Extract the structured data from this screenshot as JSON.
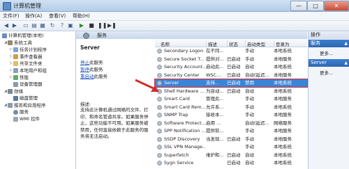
{
  "window": {
    "title": "计算机管理",
    "min_label": "—",
    "max_label": "□",
    "close_label": "✕"
  },
  "menu": [
    "文件(F)",
    "操作(A)",
    "查看(V)",
    "帮助(H)"
  ],
  "tree": {
    "root": "计算机管理(本地)",
    "system_tools": "系统工具",
    "task_scheduler": "任务计划程序",
    "event_viewer": "事件查看器",
    "shared_folders": "共享文件夹",
    "local_users": "本地用户和组",
    "performance": "性能",
    "device_manager": "设备管理器",
    "storage": "存储",
    "disk_management": "磁盘管理",
    "services_apps": "服务和应用程序",
    "services": "服务",
    "wmi": "WMI 控件"
  },
  "center": {
    "header": "服务",
    "selected_service": "Server",
    "link_stop": "停止",
    "link_stop_suffix": "此服务",
    "link_pause": "暂停",
    "link_pause_suffix": "此服务",
    "link_restart": "重启动",
    "link_restart_suffix": "此服务",
    "desc_label": "描述:",
    "desc_text": "支持此计算机通过网络的文件、打印、和命名管道共享。如果服务停止，这些功能不可用。如果服务被禁用，任何直接依赖于此服务的服务将无法启动。"
  },
  "columns": [
    "名称",
    "描述",
    "状态",
    "启动类型",
    "登录为"
  ],
  "services": [
    {
      "name": "Secondary Logon",
      "desc": "在不同...",
      "status": "",
      "startup": "手动",
      "logon": "本地系统"
    },
    {
      "name": "Secure Socket T...",
      "desc": "提供对...",
      "status": "已启动",
      "startup": "手动",
      "logon": "本地服务"
    },
    {
      "name": "Security Account...",
      "desc": "启动此...",
      "status": "已启动",
      "startup": "自动",
      "logon": "本地系统"
    },
    {
      "name": "Security Center",
      "desc": "WSC...",
      "status": "已启动",
      "startup": "自动(延迟...",
      "logon": "本地服务"
    },
    {
      "name": "Server",
      "desc": "支持...",
      "status": "已启动",
      "startup": "禁用",
      "logon": "本地系统"
    },
    {
      "name": "Shell Hardware ...",
      "desc": "为自动...",
      "status": "已启动",
      "startup": "自动",
      "logon": "本地系统"
    },
    {
      "name": "Smart Card",
      "desc": "管理此...",
      "status": "",
      "startup": "手动",
      "logon": "本地服务"
    },
    {
      "name": "Smart Card Rem...",
      "desc": "允许系...",
      "status": "",
      "startup": "手动",
      "logon": "本地系统"
    },
    {
      "name": "SNMP Trap",
      "desc": "接收本...",
      "status": "",
      "startup": "手动",
      "logon": "本地服务"
    },
    {
      "name": "Software Protect...",
      "desc": "启用 ...",
      "status": "",
      "startup": "自动(延迟...",
      "logon": "网络服务"
    },
    {
      "name": "SPP Notification ...",
      "desc": "提供软...",
      "status": "",
      "startup": "手动",
      "logon": "本地服务"
    },
    {
      "name": "SSDP Discovery",
      "desc": "当发现...",
      "status": "已启动",
      "startup": "手动",
      "logon": "本地服务"
    },
    {
      "name": "SSL VPN Manage...",
      "desc": "",
      "status": "",
      "startup": "手动",
      "logon": "本地系统"
    },
    {
      "name": "Superfetch",
      "desc": "维护和...",
      "status": "已启动",
      "startup": "自动",
      "logon": "本地系统"
    },
    {
      "name": "Sygn Service",
      "desc": "",
      "status": "已启动",
      "startup": "自动",
      "logon": "本地系统"
    }
  ],
  "actions": {
    "header": "操作",
    "section1": "服务",
    "more1": "更多...",
    "section2": "Server",
    "more2": "更多..."
  },
  "colors": {
    "selection": "#3d84d6",
    "highlight_border": "#d12c2c",
    "arrow": "#d12c2c"
  }
}
